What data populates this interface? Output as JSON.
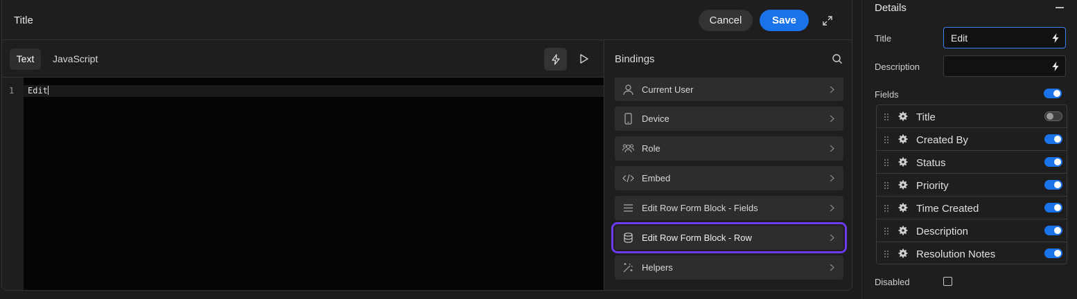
{
  "modal": {
    "title": "Title",
    "cancel_label": "Cancel",
    "save_label": "Save"
  },
  "editor": {
    "tabs": [
      {
        "label": "Text",
        "active": true
      },
      {
        "label": "JavaScript",
        "active": false
      }
    ],
    "line_number": "1",
    "code": "Edit"
  },
  "bindings": {
    "title": "Bindings",
    "items": [
      {
        "label": "Current User",
        "icon": "user-icon"
      },
      {
        "label": "Device",
        "icon": "device-icon"
      },
      {
        "label": "Role",
        "icon": "users-icon"
      },
      {
        "label": "Embed",
        "icon": "code-icon"
      },
      {
        "label": "Edit Row Form Block - Fields",
        "icon": "list-icon"
      },
      {
        "label": "Edit Row Form Block - Row",
        "icon": "database-icon",
        "selected": true
      },
      {
        "label": "Helpers",
        "icon": "magic-wand-icon"
      }
    ]
  },
  "details": {
    "title": "Details",
    "title_label": "Title",
    "title_value": "Edit",
    "description_label": "Description",
    "description_value": "",
    "fields_label": "Fields",
    "fields_enabled": true,
    "fields": [
      {
        "label": "Title",
        "enabled": false
      },
      {
        "label": "Created By",
        "enabled": true
      },
      {
        "label": "Status",
        "enabled": true
      },
      {
        "label": "Priority",
        "enabled": true
      },
      {
        "label": "Time Created",
        "enabled": true
      },
      {
        "label": "Description",
        "enabled": true
      },
      {
        "label": "Resolution Notes",
        "enabled": true
      }
    ],
    "disabled_label": "Disabled",
    "disabled_checked": false
  },
  "colors": {
    "accent": "#1a73e8",
    "selection_outline": "#6b3cf0"
  }
}
